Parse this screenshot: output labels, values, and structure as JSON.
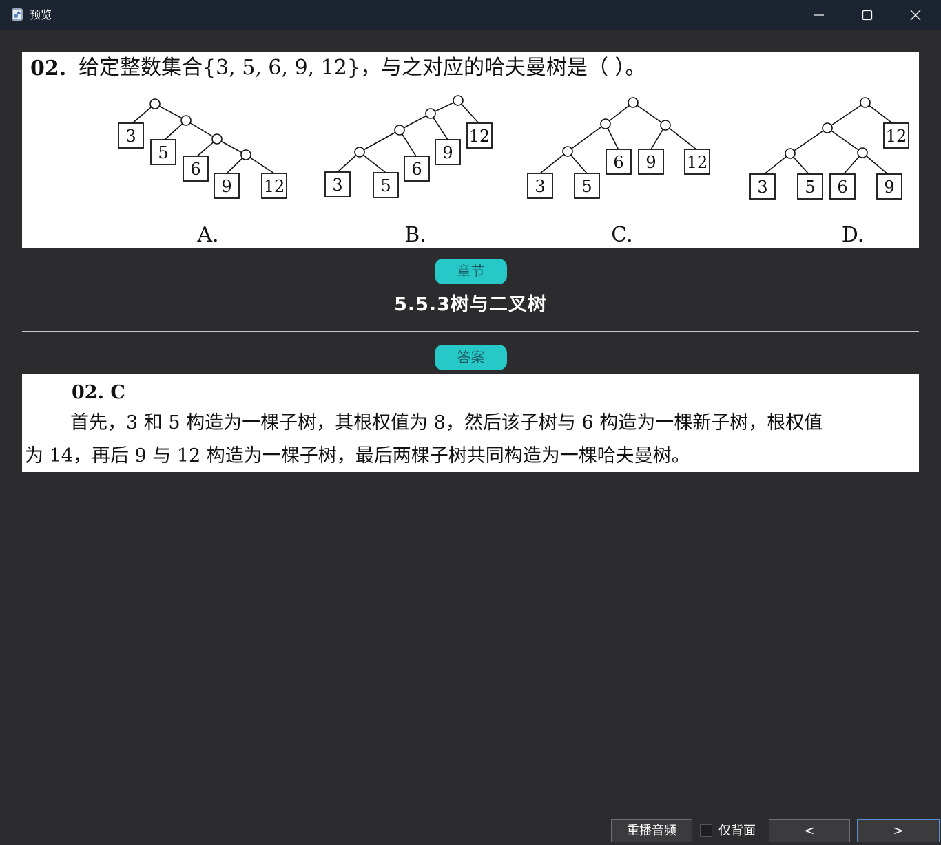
{
  "window": {
    "title": "预览"
  },
  "question": {
    "number": "02.",
    "text": "给定整数集合{3, 5, 6, 9, 12}，与之对应的哈夫曼树是（   ）。",
    "options": [
      "A.",
      "B.",
      "C.",
      "D."
    ],
    "trees": {
      "A": [
        "3",
        "5",
        "6",
        "9",
        "12"
      ],
      "B": [
        "12",
        "9",
        "3",
        "5",
        "6"
      ],
      "C": [
        "3",
        "5",
        "6",
        "9",
        "12"
      ],
      "D": [
        "12",
        "3",
        "5",
        "6",
        "9"
      ]
    }
  },
  "chapter": {
    "badge": "章节",
    "title": "5.5.3树与二叉树"
  },
  "answer": {
    "badge": "答案",
    "heading": "02.  C",
    "line1": "首先，3 和 5 构造为一棵子树，其根权值为 8，然后该子树与 6 构造为一棵新子树，根权值",
    "line2": "为 14，再后 9 与 12 构造为一棵子树，最后两棵子树共同构造为一棵哈夫曼树。"
  },
  "footer": {
    "replay_label": "重播音频",
    "back_only_label": "仅背面",
    "back_only_checked": false,
    "prev_label": "<",
    "next_label": ">"
  },
  "colors": {
    "accent": "#27c8c8",
    "titlebar": "#1c2431",
    "background": "#2c2c2e"
  }
}
